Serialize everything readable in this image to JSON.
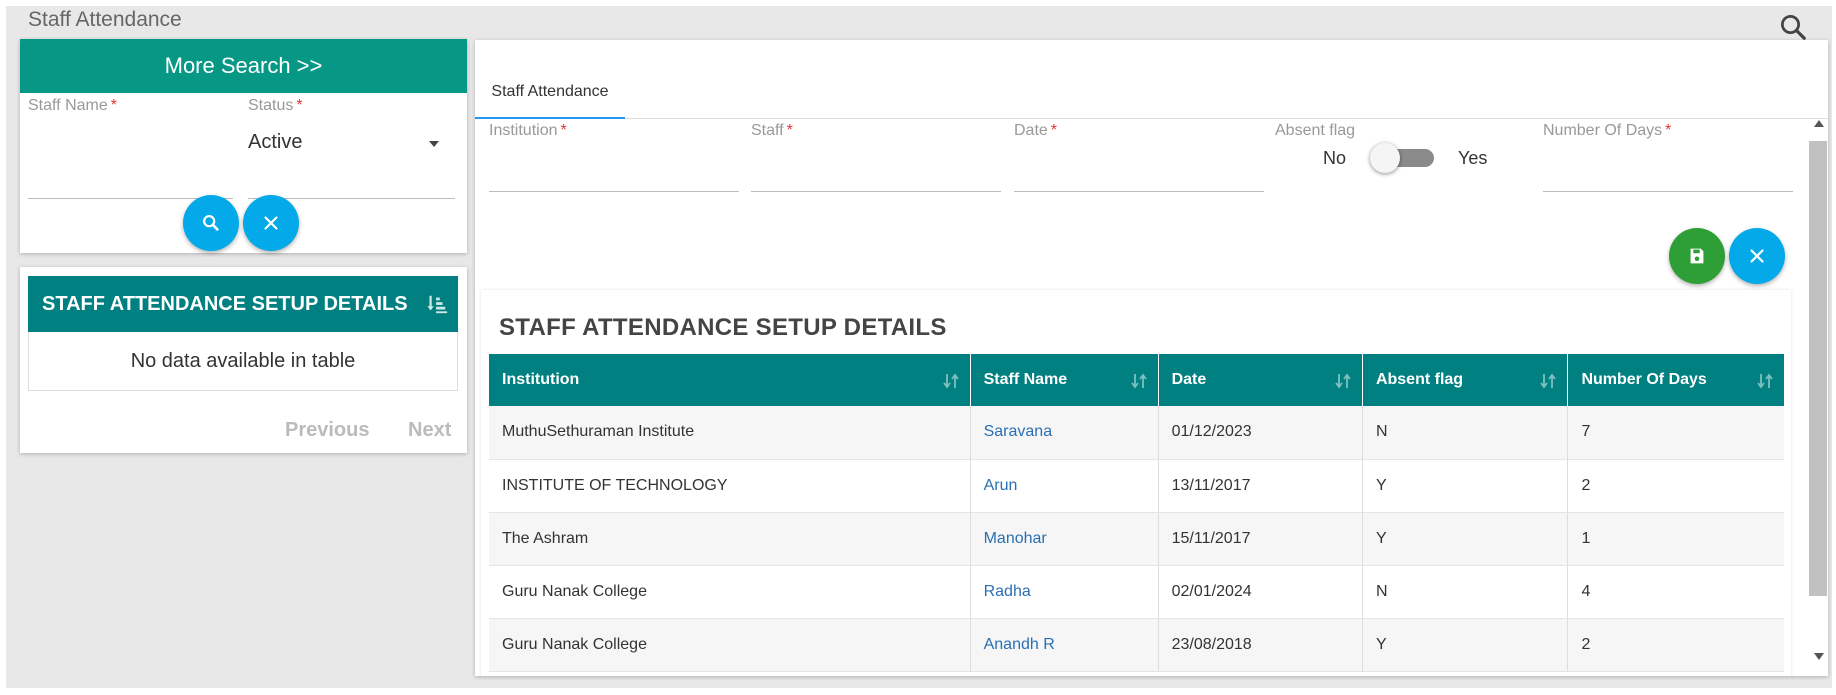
{
  "page": {
    "title": "Staff Attendance"
  },
  "search_panel": {
    "more_search": "More Search >>",
    "staff_name": {
      "label": "Staff Name",
      "value": ""
    },
    "status": {
      "label": "Status",
      "value": "Active"
    },
    "required_mark": "*"
  },
  "list_panel": {
    "title": "STAFF ATTENDANCE SETUP DETAILS",
    "empty_text": "No data available in table",
    "previous": "Previous",
    "next": "Next"
  },
  "tab": {
    "label": "Staff Attendance"
  },
  "form": {
    "institution": "Institution",
    "staff": "Staff",
    "date": "Date",
    "absent_flag": "Absent flag",
    "toggle_no": "No",
    "toggle_yes": "Yes",
    "toggle_checked": false,
    "number_of_days": "Number Of Days"
  },
  "details": {
    "title": "STAFF ATTENDANCE SETUP DETAILS",
    "columns": [
      "Institution",
      "Staff Name",
      "Date",
      "Absent flag",
      "Number Of Days"
    ],
    "rows": [
      [
        "MuthuSethuraman Institute",
        "Saravana",
        "01/12/2023",
        "N",
        "7"
      ],
      [
        "INSTITUTE OF TECHNOLOGY",
        "Arun",
        "13/11/2017",
        "Y",
        "2"
      ],
      [
        "The Ashram",
        "Manohar",
        "15/11/2017",
        "Y",
        "1"
      ],
      [
        "Guru Nanak College",
        "Radha",
        "02/01/2024",
        "N",
        "4"
      ],
      [
        "Guru Nanak College",
        "Anandh R",
        "23/08/2018",
        "Y",
        "2"
      ]
    ]
  },
  "colors": {
    "header_teal": "#008080",
    "more_search_green": "#079885",
    "button_blue": "#03a9e8",
    "button_green": "#2e9e36",
    "link_blue": "#2a6fb3",
    "required_red": "#e53935"
  },
  "icons": [
    "search-icon",
    "close-icon",
    "save-icon",
    "sort-icon",
    "sort-ascending-icon"
  ]
}
